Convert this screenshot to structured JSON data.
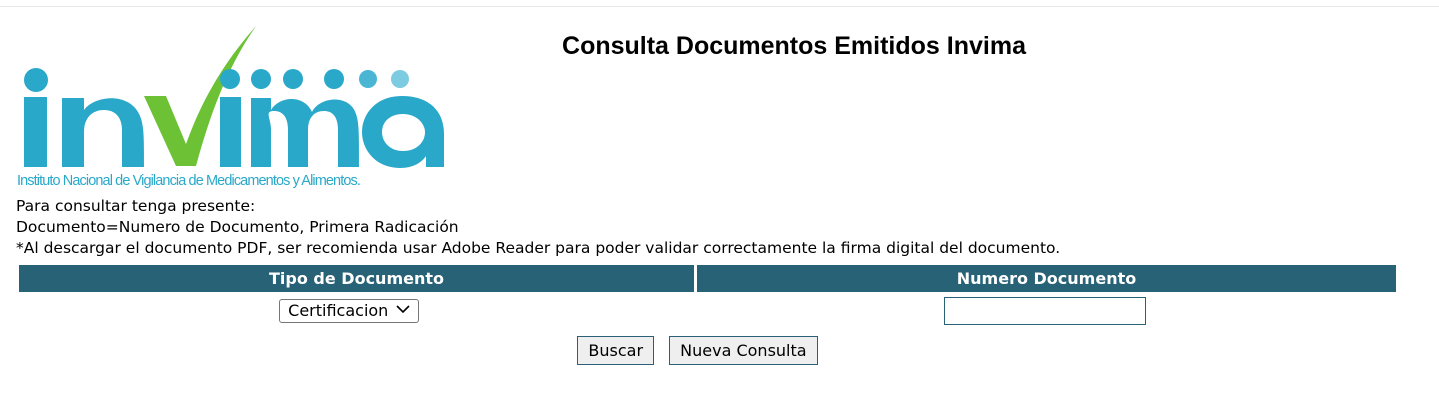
{
  "header": {
    "title": "Consulta Documentos Emitidos Invima"
  },
  "logo": {
    "wordmark": "invima",
    "caption": "Instituto Nacional de Vigilancia de Medicamentos y Alimentos.",
    "colors": {
      "primary": "#2aa8c9",
      "check": "#6cc135",
      "dot_light": "#7dcbe0"
    }
  },
  "instructions": {
    "line1": "Para consultar tenga presente:",
    "line2": "Documento=Numero de Documento, Primera Radicación",
    "line3": "*Al descargar el documento PDF, ser recomienda usar Adobe Reader para poder validar correctamente la firma digital del documento."
  },
  "form": {
    "col_tipo_header": "Tipo de Documento",
    "col_numero_header": "Numero Documento",
    "tipo_selected": "Certificacion",
    "tipo_icon": "chevron-down-icon",
    "numero_value": "",
    "header_color": "#286276"
  },
  "actions": {
    "buscar_label": "Buscar",
    "nueva_label": "Nueva Consulta"
  }
}
